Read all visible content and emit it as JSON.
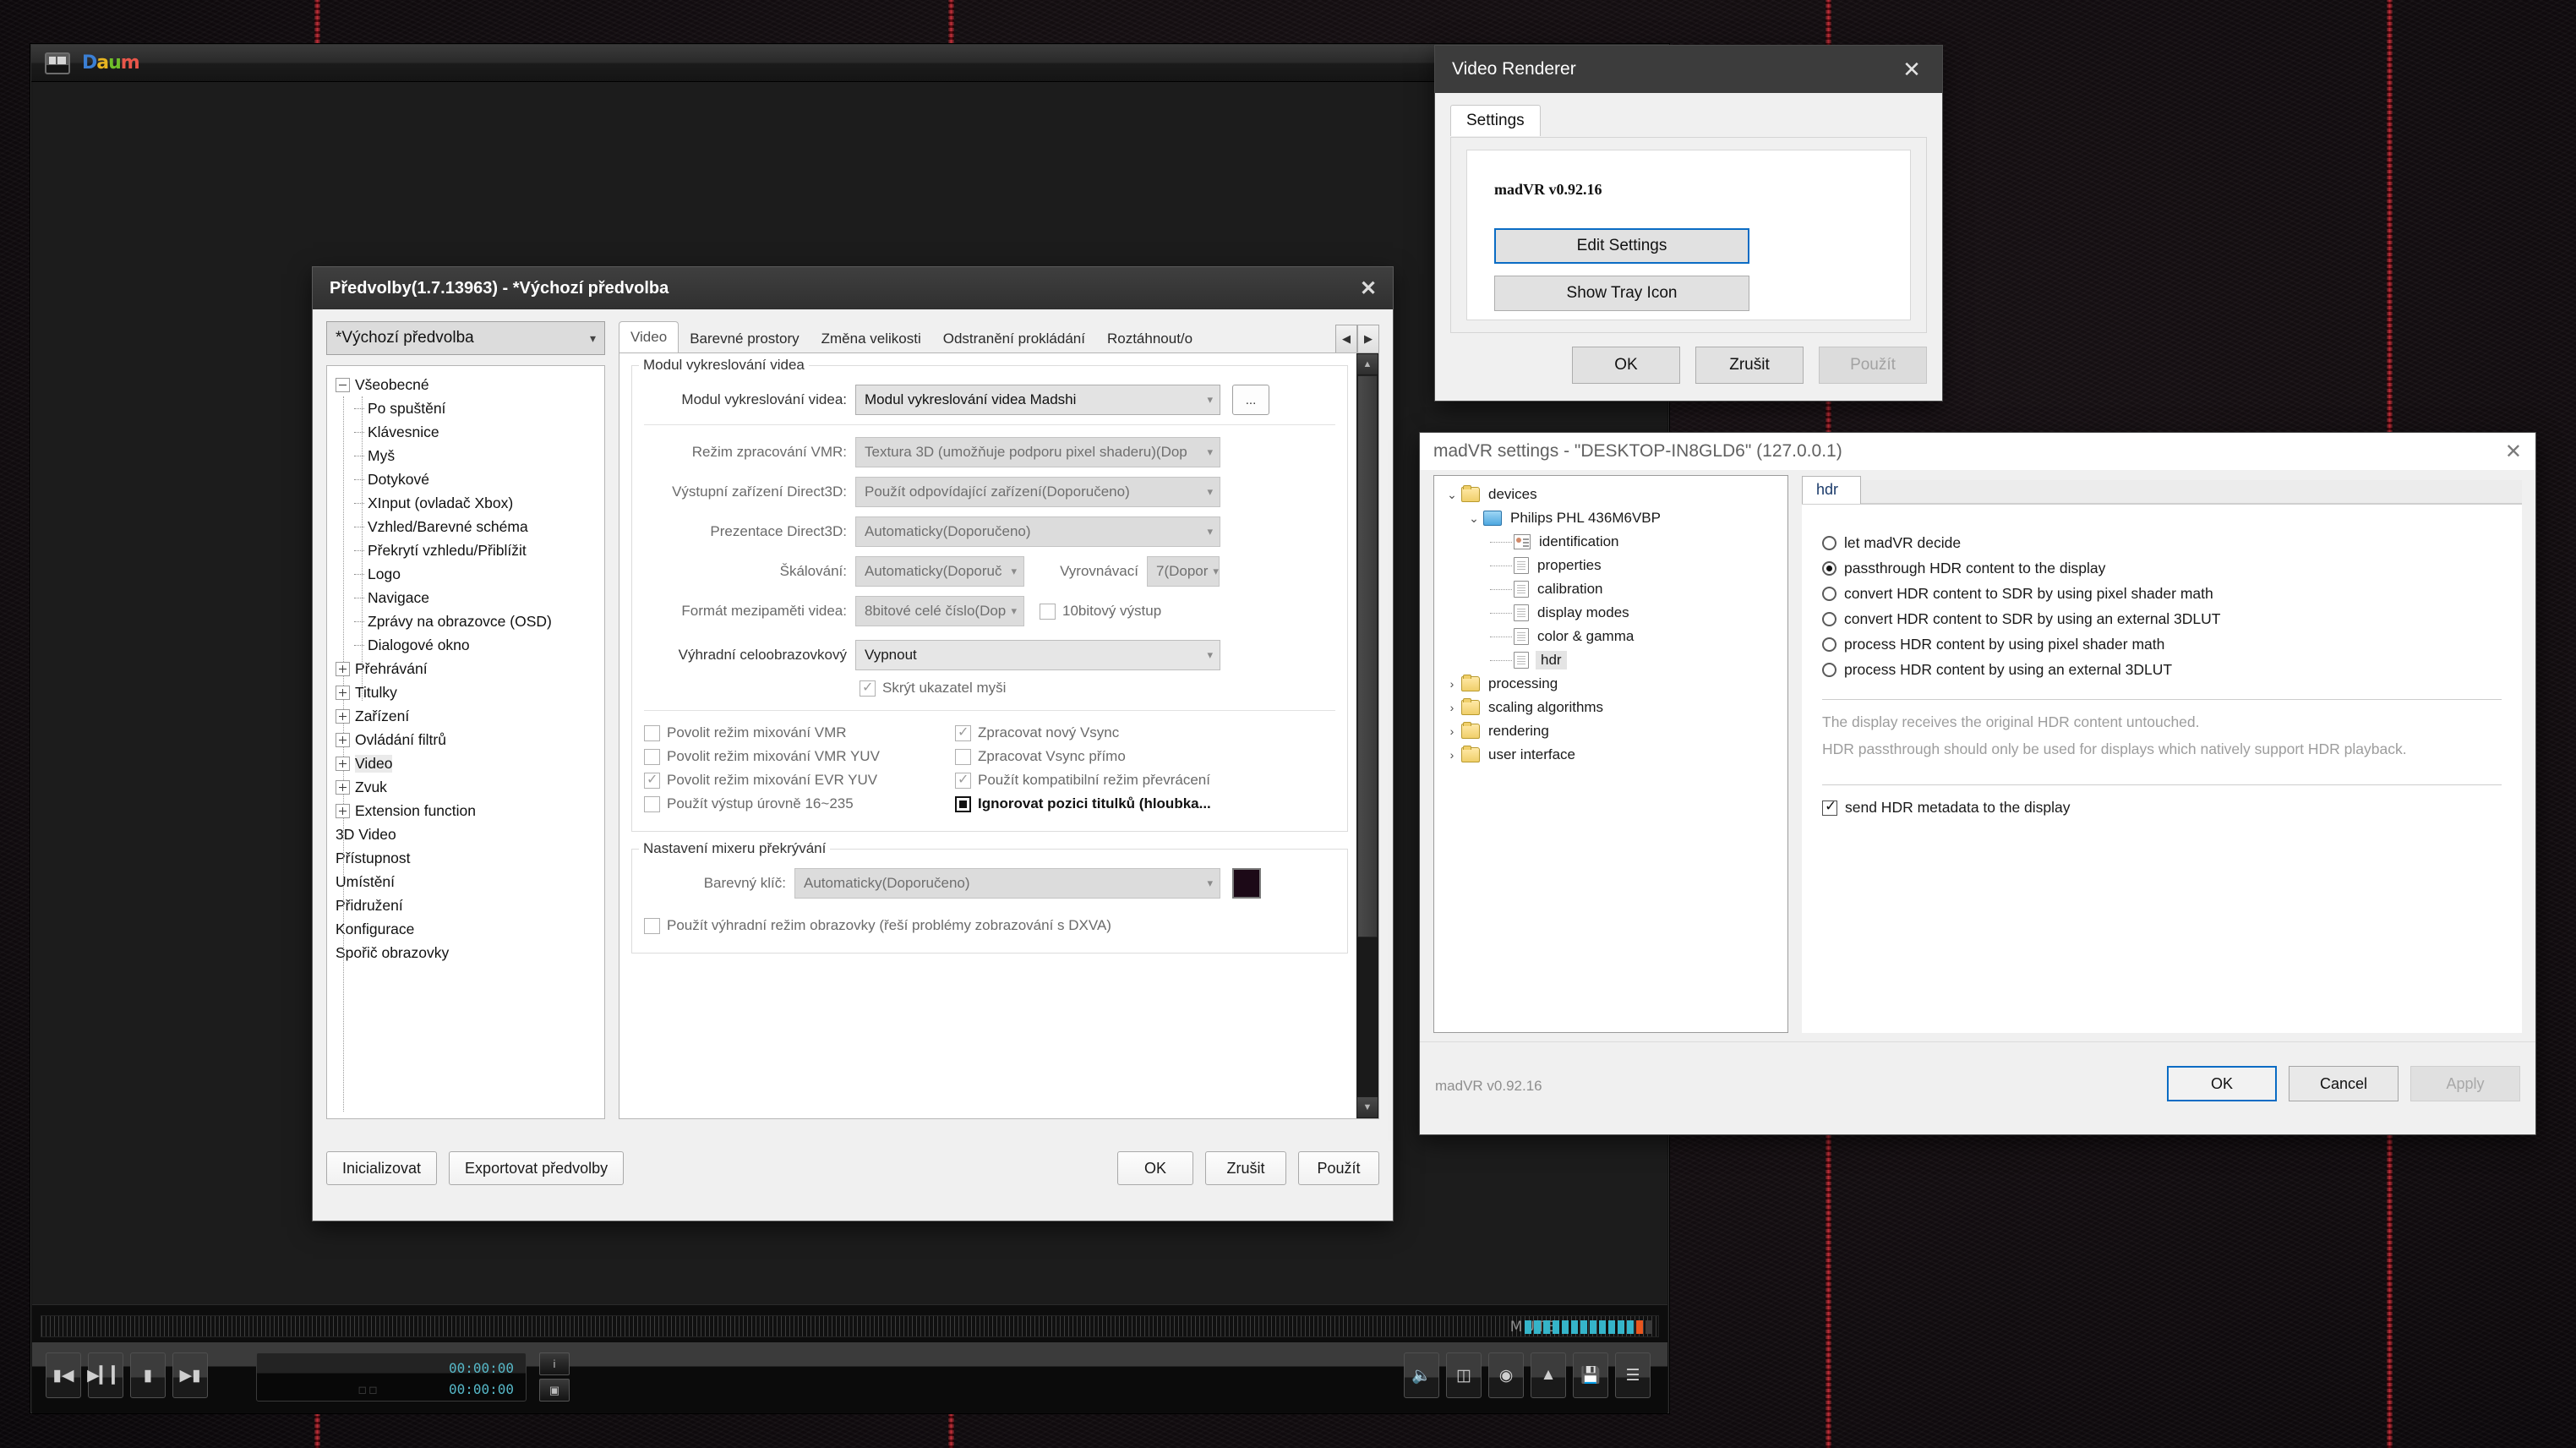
{
  "player": {
    "app_name": "Daum",
    "window_icon": "window-restore-icon",
    "logo_letters": [
      "D",
      "a",
      "u",
      "m"
    ],
    "controls": {
      "prev_icon": "skip-previous-icon",
      "play_pause_icon": "play-pause-icon",
      "stop_icon": "stop-icon",
      "next_icon": "skip-next-icon",
      "info_icon": "info-icon",
      "screenshot_icon": "screenshot-icon",
      "volume_icon": "speaker-icon",
      "subtitle_icon": "subtitle-icon",
      "disc_icon": "disc-icon",
      "eject_icon": "eject-icon",
      "save_icon": "floppy-save-icon",
      "playlist_icon": "playlist-icon"
    },
    "time_current": "00:00:00",
    "time_total": "00:00:00",
    "mute_label": "MUTE"
  },
  "prefs": {
    "title": "Předvolby(1.7.13963) - *Výchozí předvolba",
    "close_icon": "close-icon",
    "preset": "*Výchozí předvolba",
    "preset_chevron": "chevron-down-icon",
    "tree": [
      {
        "label": "Všeobecné",
        "level": 0,
        "toggle": "minus"
      },
      {
        "label": "Po spuštění",
        "level": 1,
        "toggle": "none"
      },
      {
        "label": "Klávesnice",
        "level": 1,
        "toggle": "none"
      },
      {
        "label": "Myš",
        "level": 1,
        "toggle": "none"
      },
      {
        "label": "Dotykové",
        "level": 1,
        "toggle": "none"
      },
      {
        "label": "XInput (ovladač Xbox)",
        "level": 1,
        "toggle": "none"
      },
      {
        "label": "Vzhled/Barevné schéma",
        "level": 1,
        "toggle": "none"
      },
      {
        "label": "Překrytí vzhledu/Přiblížit",
        "level": 1,
        "toggle": "none"
      },
      {
        "label": "Logo",
        "level": 1,
        "toggle": "none"
      },
      {
        "label": "Navigace",
        "level": 1,
        "toggle": "none"
      },
      {
        "label": "Zprávy na obrazovce (OSD)",
        "level": 1,
        "toggle": "none"
      },
      {
        "label": "Dialogové okno",
        "level": 1,
        "toggle": "none"
      },
      {
        "label": "Přehrávání",
        "level": 0,
        "toggle": "plus"
      },
      {
        "label": "Titulky",
        "level": 0,
        "toggle": "plus"
      },
      {
        "label": "Zařízení",
        "level": 0,
        "toggle": "plus"
      },
      {
        "label": "Ovládání filtrů",
        "level": 0,
        "toggle": "plus"
      },
      {
        "label": "Video",
        "level": 0,
        "toggle": "plus",
        "selected": true
      },
      {
        "label": "Zvuk",
        "level": 0,
        "toggle": "plus"
      },
      {
        "label": "Extension function",
        "level": 0,
        "toggle": "plus"
      },
      {
        "label": "3D Video",
        "level": 0,
        "toggle": "none"
      },
      {
        "label": "Přístupnost",
        "level": 0,
        "toggle": "none"
      },
      {
        "label": "Umístění",
        "level": 0,
        "toggle": "none"
      },
      {
        "label": "Přidružení",
        "level": 0,
        "toggle": "none"
      },
      {
        "label": "Konfigurace",
        "level": 0,
        "toggle": "none"
      },
      {
        "label": "Spořič obrazovky",
        "level": 0,
        "toggle": "none"
      }
    ],
    "tabs": [
      {
        "label": "Video",
        "active": true
      },
      {
        "label": "Barevné prostory",
        "active": false
      },
      {
        "label": "Změna velikosti",
        "active": false
      },
      {
        "label": "Odstranění prokládání",
        "active": false
      },
      {
        "label": "Roztáhnout/o",
        "active": false
      }
    ],
    "tab_prev_icon": "chevron-left-icon",
    "tab_next_icon": "chevron-right-icon",
    "group_renderer": {
      "title": "Modul vykreslování videa",
      "renderer_label": "Modul vykreslování videa:",
      "renderer_value": "Modul vykreslování videa Madshi",
      "dots_label": "...",
      "vmr_label": "Režim zpracování VMR:",
      "vmr_value": "Textura 3D (umožňuje podporu pixel shaderu)(Dop",
      "d3d_out_label": "Výstupní zařízení Direct3D:",
      "d3d_out_value": "Použít odpovídající zařízení(Doporučeno)",
      "d3d_pres_label": "Prezentace Direct3D:",
      "d3d_pres_value": "Automaticky(Doporučeno)",
      "scaling_label": "Škálování:",
      "scaling_value": "Automaticky(Doporuč",
      "buffer_label": "Vyrovnávací",
      "buffer_value": "7(Dopor",
      "videobuf_label": "Formát mezipaměti videa:",
      "videobuf_value": "8bitové celé číslo(Dop",
      "tenbit_label": "10bitový výstup",
      "tenbit_checked": false,
      "fullscreen_label": "Výhradní celoobrazovkový",
      "fullscreen_value": "Vypnout",
      "hide_cursor_label": "Skrýt ukazatel myši",
      "hide_cursor_checked": true,
      "checks_left": [
        {
          "label": "Povolit režim mixování VMR",
          "state": "off"
        },
        {
          "label": "Povolit režim mixování VMR YUV",
          "state": "off"
        },
        {
          "label": "Povolit režim mixování EVR YUV",
          "state": "checked"
        },
        {
          "label": "Použít výstup úrovně 16~235",
          "state": "off"
        }
      ],
      "checks_right": [
        {
          "label": "Zpracovat nový Vsync",
          "state": "checked"
        },
        {
          "label": "Zpracovat Vsync přímo",
          "state": "off"
        },
        {
          "label": "Použít kompatibilní režim převrácení",
          "state": "checked"
        },
        {
          "label": "Ignorovat pozici titulků (hloubka...",
          "state": "filled",
          "bold": true
        }
      ]
    },
    "group_overlay": {
      "title": "Nastavení mixeru překrývání",
      "colorkey_label": "Barevný klíč:",
      "colorkey_value": "Automaticky(Doporučeno)",
      "colorkey_swatch": "#1c0917",
      "exclusive_label": "Použít výhradní režim obrazovky (řeší problémy zobrazování s DXVA)",
      "exclusive_checked": false
    },
    "footer": {
      "init": "Inicializovat",
      "export": "Exportovat předvolby",
      "ok": "OK",
      "cancel": "Zrušit",
      "apply": "Použít"
    },
    "scroll_up_icon": "scroll-up-icon",
    "scroll_down_icon": "scroll-down-icon"
  },
  "video_renderer": {
    "title": "Video Renderer",
    "close_icon": "close-icon",
    "tab": "Settings",
    "version": "madVR v0.92.16",
    "edit_settings": "Edit Settings",
    "show_tray_icon": "Show Tray Icon",
    "ok": "OK",
    "cancel": "Zrušit",
    "apply": "Použít"
  },
  "madvr": {
    "title": "madVR settings - \"DESKTOP-IN8GLD6\" (127.0.0.1)",
    "close_icon": "close-icon",
    "tree": [
      {
        "label": "devices",
        "icon": "folder-icon",
        "chevron": "chevron-down-icon",
        "indent": 0
      },
      {
        "label": "Philips PHL 436M6VBP",
        "icon": "monitor-icon",
        "chevron": "chevron-down-icon",
        "indent": 1
      },
      {
        "label": "identification",
        "icon": "identification-icon",
        "chevron": "",
        "indent": 2
      },
      {
        "label": "properties",
        "icon": "page-icon",
        "chevron": "",
        "indent": 2
      },
      {
        "label": "calibration",
        "icon": "page-icon",
        "chevron": "",
        "indent": 2
      },
      {
        "label": "display modes",
        "icon": "page-icon",
        "chevron": "",
        "indent": 2
      },
      {
        "label": "color & gamma",
        "icon": "page-icon",
        "chevron": "",
        "indent": 2
      },
      {
        "label": "hdr",
        "icon": "page-icon",
        "chevron": "",
        "indent": 2,
        "selected": true
      },
      {
        "label": "processing",
        "icon": "folder-icon",
        "chevron": "chevron-right-icon",
        "indent": 0
      },
      {
        "label": "scaling algorithms",
        "icon": "folder-icon",
        "chevron": "chevron-right-icon",
        "indent": 0
      },
      {
        "label": "rendering",
        "icon": "folder-icon",
        "chevron": "chevron-right-icon",
        "indent": 0
      },
      {
        "label": "user interface",
        "icon": "folder-icon",
        "chevron": "chevron-right-icon",
        "indent": 0
      }
    ],
    "tab": "hdr",
    "options": [
      {
        "label": "let madVR decide",
        "selected": false
      },
      {
        "label": "passthrough HDR content to the display",
        "selected": true
      },
      {
        "label": "convert HDR content to SDR by using pixel shader math",
        "selected": false
      },
      {
        "label": "convert HDR content to SDR by using an external 3DLUT",
        "selected": false
      },
      {
        "label": "process HDR content by using pixel shader math",
        "selected": false
      },
      {
        "label": "process HDR content by using an external 3DLUT",
        "selected": false
      }
    ],
    "desc1": "The display receives the original HDR content untouched.",
    "desc2": "HDR passthrough should only be used for displays which natively support HDR playback.",
    "send_metadata_label": "send HDR metadata to the display",
    "send_metadata_checked": true,
    "version": "madVR v0.92.16",
    "ok": "OK",
    "cancel": "Cancel",
    "apply": "Apply"
  },
  "colors": {
    "accent_blue": "#0a6cc4",
    "title_dark": "#3c3c3c",
    "dialog_bg": "#f0f0f0",
    "wallpaper": "#15101 3",
    "stitch_red": "#cf1d28"
  }
}
